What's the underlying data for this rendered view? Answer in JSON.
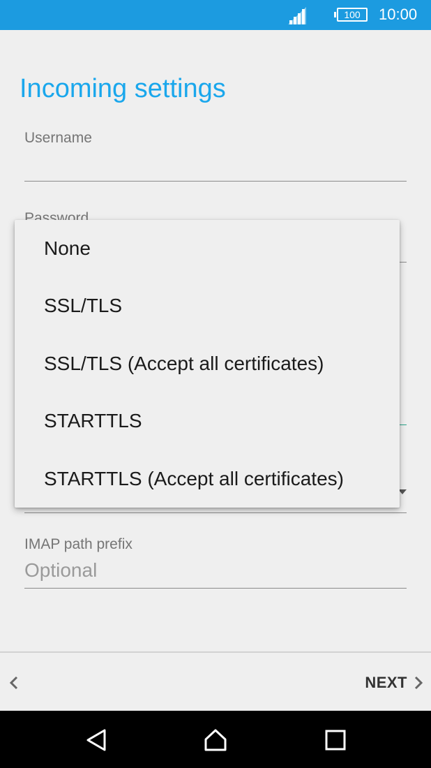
{
  "status_bar": {
    "battery": "100",
    "time": "10:00",
    "icons": [
      "signal-icon",
      "battery-icon"
    ]
  },
  "page": {
    "title": "Incoming settings"
  },
  "fields": {
    "username_label": "Username",
    "password_label": "Password",
    "imap_prefix_label": "IMAP path prefix",
    "imap_prefix_placeholder": "Optional"
  },
  "security_dropdown": {
    "options": [
      "None",
      "SSL/TLS",
      "SSL/TLS (Accept all certificates)",
      "STARTTLS",
      "STARTTLS (Accept all certificates)"
    ]
  },
  "bottom_bar": {
    "next_label": "NEXT",
    "icons": [
      "chevron-left-icon",
      "chevron-right-icon"
    ]
  },
  "nav_bar": {
    "icons": [
      "back-icon",
      "home-icon",
      "recents-icon"
    ]
  },
  "colors": {
    "status_bar": "#1c9be0",
    "title": "#1aa7ec",
    "accent_line": "#2aa58a"
  }
}
